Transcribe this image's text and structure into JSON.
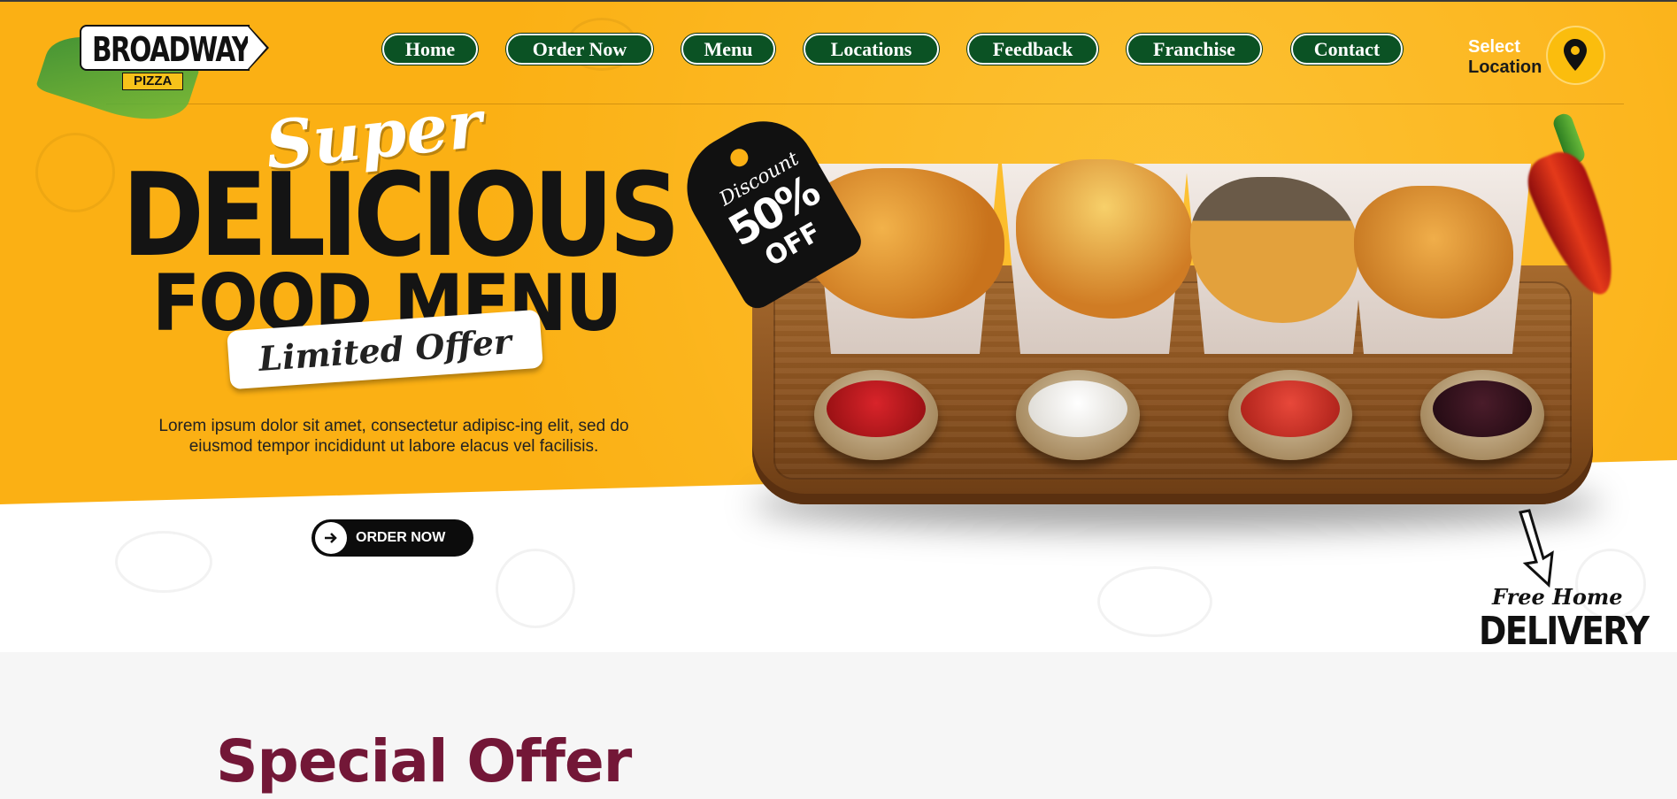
{
  "logo": {
    "name": "BROADWAY",
    "sub": "PIZZA"
  },
  "nav": {
    "items": [
      {
        "label": "Home"
      },
      {
        "label": "Order Now"
      },
      {
        "label": "Menu"
      },
      {
        "label": "Locations"
      },
      {
        "label": "Feedback"
      },
      {
        "label": "Franchise"
      },
      {
        "label": "Contact"
      }
    ],
    "select_location": {
      "line1": "Select",
      "line2": "Location",
      "icon": "map-pin-icon"
    }
  },
  "hero": {
    "script_word": "Super",
    "headline_1": "DELICIOUS",
    "headline_2": "FOOD MENU",
    "badge": "Limited Offer",
    "description": "Lorem ipsum dolor sit amet, consectetur adipisc-ing elit, sed do eiusmod tempor incididunt ut labore elacus vel facilisis.",
    "order_button": "ORDER NOW",
    "discount_tag": {
      "label": "Discount",
      "percent": "50%",
      "off": "OFF"
    },
    "delivery": {
      "line1": "Free Home",
      "line2": "DELIVERY"
    }
  },
  "colors": {
    "hero_yellow": "#fbb014",
    "nav_green": "#0b5224",
    "special_title": "#731737"
  },
  "section": {
    "title": "Special Offer"
  }
}
